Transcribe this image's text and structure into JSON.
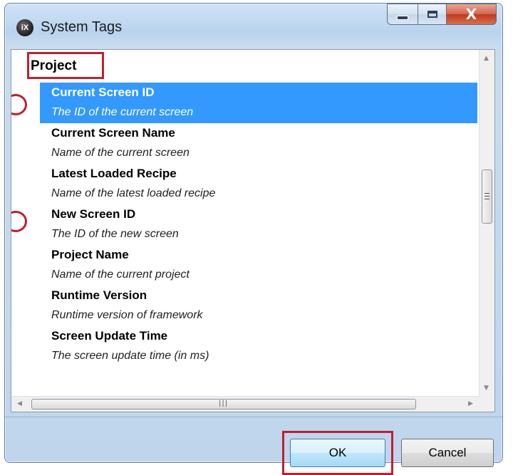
{
  "window": {
    "title": "System Tags",
    "app_icon_text": "iX",
    "controls": {
      "minimize": "minimize",
      "maximize": "maximize",
      "close": "X"
    }
  },
  "list": {
    "category": "Project",
    "items": [
      {
        "name": "Current Screen ID",
        "description": "The ID of the current screen",
        "selected": true
      },
      {
        "name": "Current Screen Name",
        "description": "Name of the current screen",
        "selected": false
      },
      {
        "name": "Latest Loaded Recipe",
        "description": "Name of the latest loaded recipe",
        "selected": false
      },
      {
        "name": "New Screen ID",
        "description": "The ID of the new screen",
        "selected": false
      },
      {
        "name": "Project Name",
        "description": "Name of the current project",
        "selected": false
      },
      {
        "name": "Runtime Version",
        "description": "Runtime version of framework",
        "selected": false
      },
      {
        "name": "Screen Update Time",
        "description": "The screen update time (in ms)",
        "selected": false
      }
    ]
  },
  "buttons": {
    "ok": "OK",
    "cancel": "Cancel"
  },
  "colors": {
    "selection": "#3399ff",
    "annotation": "#c0202e"
  }
}
